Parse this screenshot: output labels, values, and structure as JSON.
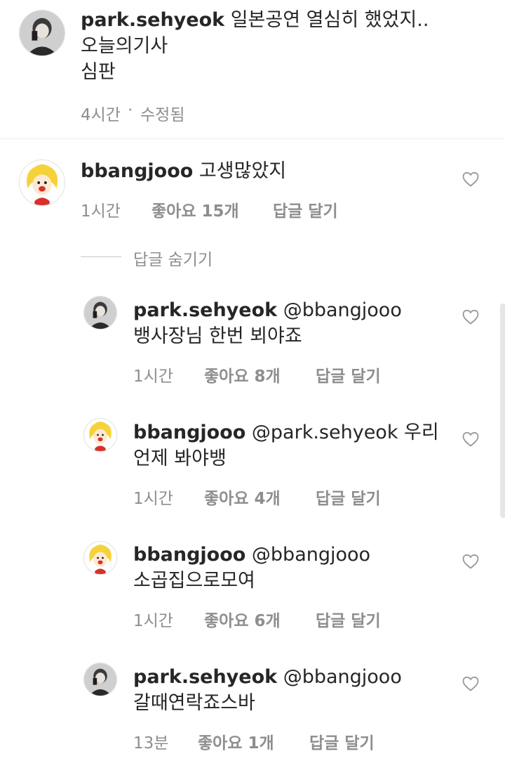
{
  "caption": {
    "username": "park.sehyeok",
    "text_line1": "일본공연 열심히 했었지..",
    "text_line2": "오늘의기사",
    "text_line3": "심판",
    "time": "4시간",
    "separator": "·",
    "edited": "수정됨"
  },
  "comment": {
    "username": "bbangjooo",
    "text": "고생많았지",
    "time": "1시간",
    "likes": "좋아요 15개",
    "reply": "답글 달기"
  },
  "hide_replies_label": "답글 숨기기",
  "replies": [
    {
      "username": "park.sehyeok",
      "text_line1": "@bbangjooo",
      "text_line2": "뱅사장님 한번 뵈야죠",
      "time": "1시간",
      "likes": "좋아요 8개",
      "reply": "답글 달기"
    },
    {
      "username": "bbangjooo",
      "text_line1": "@park.sehyeok 우리",
      "text_line2": "언제 봐야뱅",
      "time": "1시간",
      "likes": "좋아요 4개",
      "reply": "답글 달기"
    },
    {
      "username": "bbangjooo",
      "text_line1": "@bbangjooo",
      "text_line2": "소곱집으로모여",
      "time": "1시간",
      "likes": "좋아요 6개",
      "reply": "답글 달기"
    },
    {
      "username": "park.sehyeok",
      "text_line1": "@bbangjooo",
      "text_line2": "갈때연락죠스바",
      "time": "13분",
      "likes": "좋아요 1개",
      "reply": "답글 달기"
    }
  ],
  "colors": {
    "text": "#262626",
    "secondary": "#8e8e8e",
    "divider": "#ececec"
  },
  "icons": {
    "like": "heart-outline-icon"
  }
}
